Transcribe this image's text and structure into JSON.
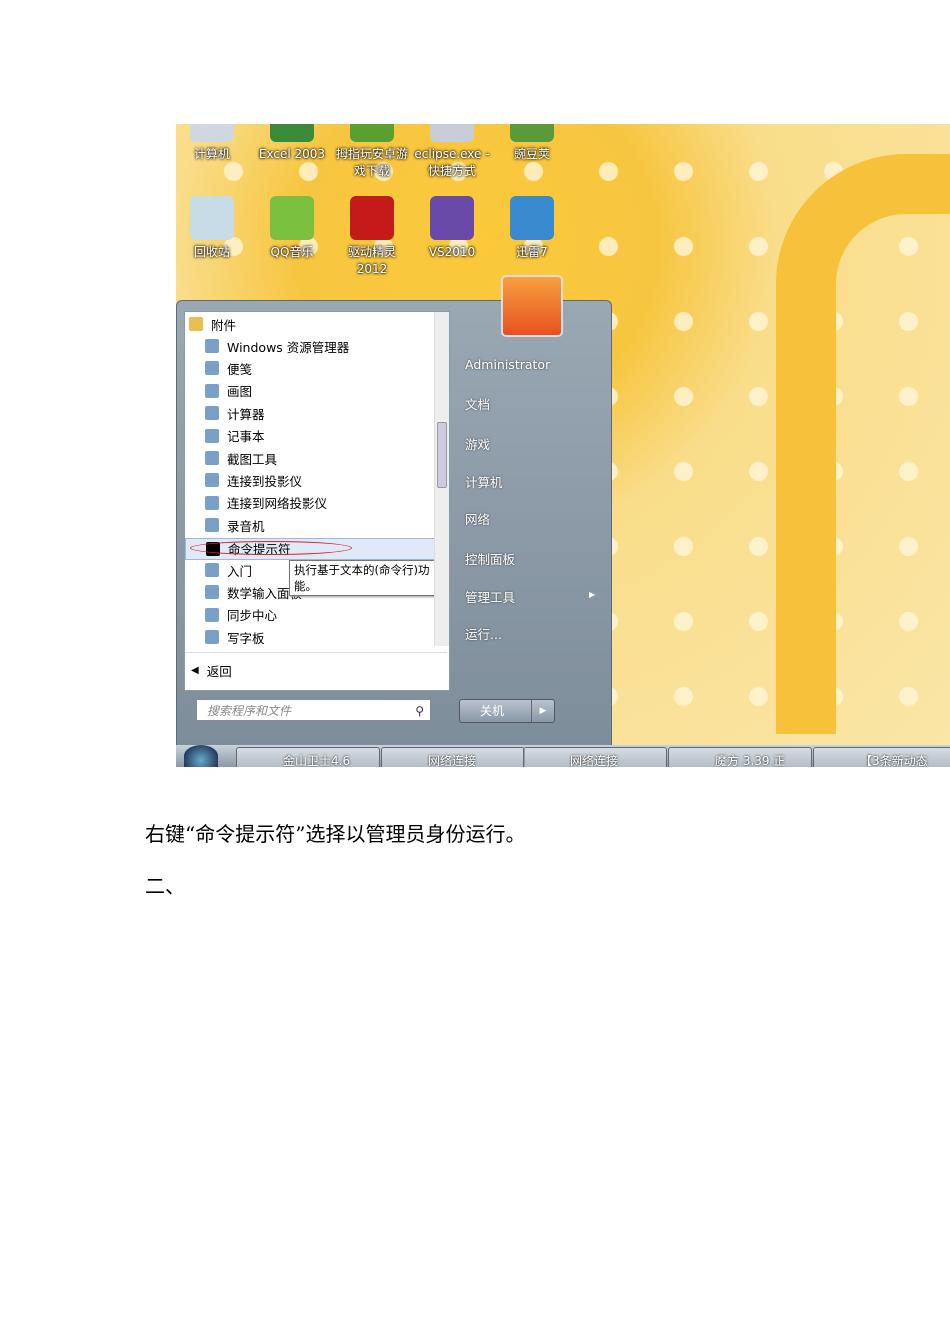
{
  "desktop_icons": [
    {
      "label": "计算机"
    },
    {
      "label": "Excel 2003"
    },
    {
      "label": "拇指玩安卓游戏下载"
    },
    {
      "label": "eclipse.exe - 快捷方式"
    },
    {
      "label": "豌豆荚"
    },
    {
      "label": "回收站"
    },
    {
      "label": "QQ音乐"
    },
    {
      "label": "驱动精灵2012"
    },
    {
      "label": "VS2010"
    },
    {
      "label": "迅雷7"
    }
  ],
  "start_menu": {
    "folder": "附件",
    "items": [
      "Windows 资源管理器",
      "便笺",
      "画图",
      "计算器",
      "记事本",
      "截图工具",
      "连接到投影仪",
      "连接到网络投影仪",
      "录音机",
      "命令提示符",
      "入门",
      "数学输入面板",
      "同步中心",
      "写字板"
    ],
    "tooltip": "执行基于文本的(命令行)功能。",
    "back": "返回",
    "search_placeholder": "搜索程序和文件",
    "right_items": [
      "Administrator",
      "文档",
      "游戏",
      "计算机",
      "网络",
      "控制面板",
      "管理工具",
      "运行..."
    ],
    "shutdown": "关机"
  },
  "taskbar": [
    "金山卫士4.6",
    "网络连接",
    "网络连接",
    "魔方 3.39 正",
    "【3条新动态"
  ],
  "doc": {
    "para1": "右键“命令提示符”选择以管理员身份运行。",
    "para2": "二、"
  }
}
